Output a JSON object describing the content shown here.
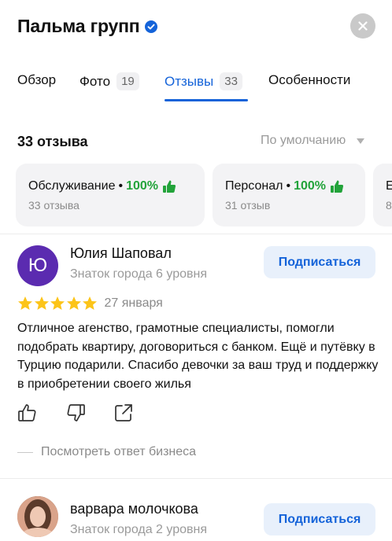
{
  "header": {
    "title": "Пальма групп",
    "verified_icon": "verified-check-icon",
    "close_icon": "close-icon"
  },
  "tabs": [
    {
      "label": "Обзор",
      "count": ""
    },
    {
      "label": "Фото",
      "count": "19"
    },
    {
      "label": "Отзывы",
      "count": "33",
      "active": true
    },
    {
      "label": "Особенности",
      "count": ""
    }
  ],
  "reviews_summary": {
    "count_label": "33 отзыва",
    "sort_label": "По умолчанию"
  },
  "aspects": [
    {
      "name": "Обслуживание",
      "percent": "100%",
      "sub": "33 отзыва"
    },
    {
      "name": "Персонал",
      "percent": "100%",
      "sub": "31 отзыв"
    },
    {
      "name": "Е",
      "percent": "",
      "sub": "8"
    }
  ],
  "reviews": [
    {
      "avatar_letter": "Ю",
      "author": "Юлия Шаповал",
      "level": "Знаток города 6 уровня",
      "subscribe_label": "Подписаться",
      "rating": 5,
      "date": "27 января",
      "text": "Отличное агенство, грамотные специалисты, помогли подобрать квартиру, договориться с банком. Ещё и путёвку в Турцию подарили. Спасибо девочки за ваш труд и поддержку в приобретении своего жилья",
      "reply_link": "Посмотреть ответ бизнеса"
    },
    {
      "author": "варвара молочкова",
      "level": "Знаток города 2 уровня",
      "subscribe_label": "Подписаться"
    }
  ],
  "colors": {
    "accent": "#1463d9",
    "green": "#22a33a",
    "star": "#fcc419",
    "avatar_purple": "#5b2bb0"
  }
}
